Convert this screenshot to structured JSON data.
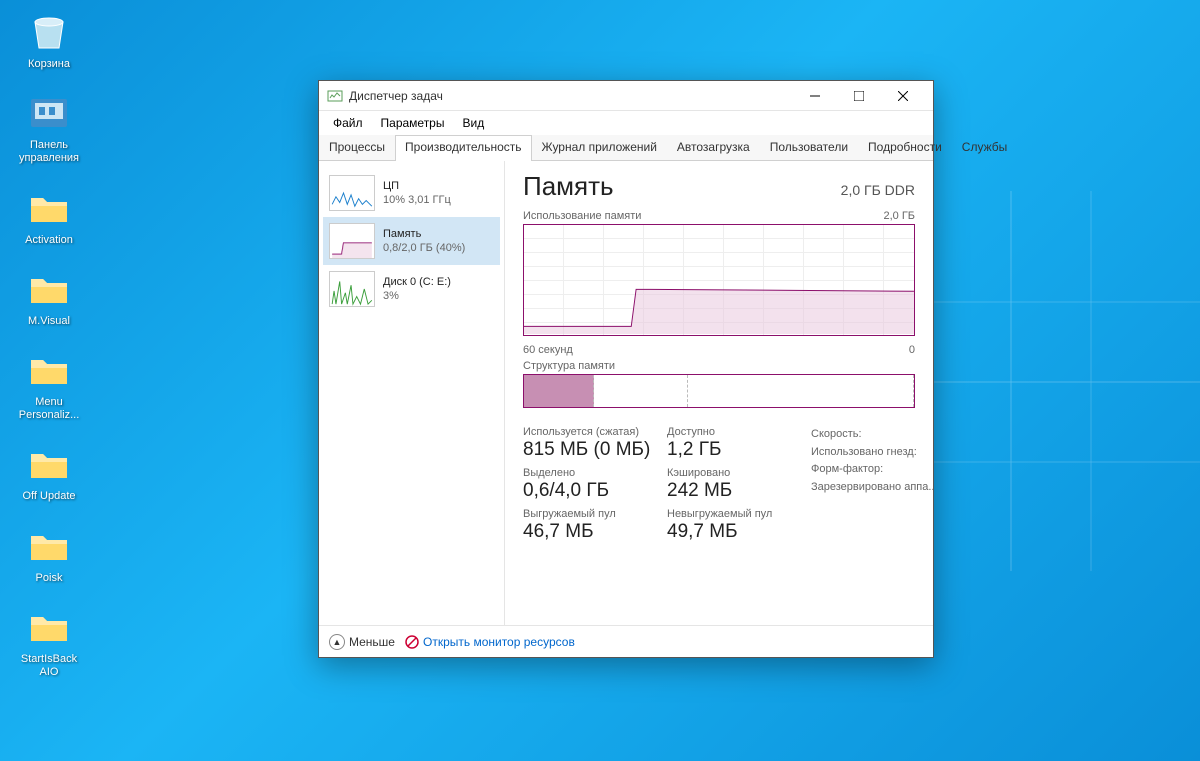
{
  "desktop_icons": [
    {
      "label": "Корзина",
      "type": "recycle"
    },
    {
      "label": "Панель управления",
      "type": "control"
    },
    {
      "label": "Activation",
      "type": "folder"
    },
    {
      "label": "M.Visual",
      "type": "folder"
    },
    {
      "label": "Menu Personaliz...",
      "type": "folder"
    },
    {
      "label": "Off Update",
      "type": "folder"
    },
    {
      "label": "Poisk",
      "type": "folder"
    },
    {
      "label": "StartIsBack AIO",
      "type": "folder"
    }
  ],
  "window": {
    "title": "Диспетчер задач",
    "menu": [
      "Файл",
      "Параметры",
      "Вид"
    ],
    "tabs": [
      "Процессы",
      "Производительность",
      "Журнал приложений",
      "Автозагрузка",
      "Пользователи",
      "Подробности",
      "Службы"
    ],
    "active_tab": 1,
    "sidebar": [
      {
        "title": "ЦП",
        "sub": "10% 3,01 ГГц",
        "color": "#1b7fcc"
      },
      {
        "title": "Память",
        "sub": "0,8/2,0 ГБ (40%)",
        "color": "#8c0f6b",
        "selected": true
      },
      {
        "title": "Диск 0 (C: E:)",
        "sub": "3%",
        "color": "#3a9e3a"
      }
    ],
    "main": {
      "heading": "Память",
      "heading_right": "2,0 ГБ DDR",
      "usage_label": "Использование памяти",
      "usage_right": "2,0 ГБ",
      "time_left": "60 секунд",
      "time_right": "0",
      "struct_label": "Структура памяти",
      "stats_row1": [
        {
          "label": "Используется (сжатая)",
          "value": "815 МБ (0 МБ)"
        },
        {
          "label": "Доступно",
          "value": "1,2 ГБ"
        }
      ],
      "rlabels": [
        "Скорость:",
        "Использовано гнезд:",
        "Форм-фактор:",
        "Зарезервировано аппа..."
      ],
      "stats_row2": [
        {
          "label": "Выделено",
          "value": "0,6/4,0 ГБ"
        },
        {
          "label": "Кэшировано",
          "value": "242 МБ"
        }
      ],
      "stats_row3": [
        {
          "label": "Выгружаемый пул",
          "value": "46,7 МБ"
        },
        {
          "label": "Невыгружаемый пул",
          "value": "49,7 МБ"
        }
      ]
    },
    "footer": {
      "fewer": "Меньше",
      "resmon": "Открыть монитор ресурсов"
    }
  },
  "chart_data": {
    "type": "line",
    "title": "Использование памяти",
    "xlabel": "секунд",
    "ylabel": "ГБ",
    "x_range": [
      60,
      0
    ],
    "ylim": [
      0,
      2.0
    ],
    "series": [
      {
        "name": "Память",
        "values_gb_over_time": [
          0.15,
          0.15,
          0.15,
          0.15,
          0.15,
          0.15,
          0.15,
          0.15,
          0.82,
          0.82,
          0.82,
          0.82,
          0.82,
          0.82,
          0.82,
          0.82,
          0.82,
          0.82,
          0.82,
          0.82,
          0.82,
          0.82,
          0.82,
          0.82,
          0.82,
          0.82,
          0.82,
          0.82,
          0.82,
          0.82
        ]
      }
    ]
  }
}
